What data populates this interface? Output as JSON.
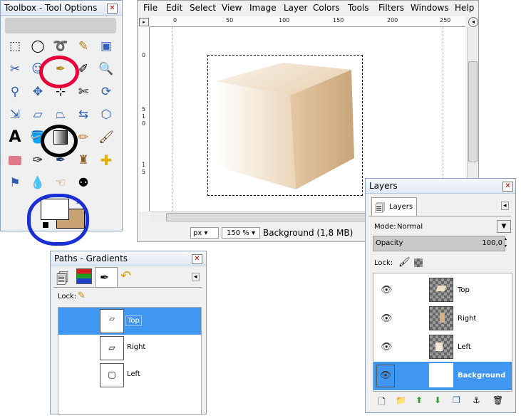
{
  "toolbox": {
    "title": "Toolbox - Tool Options",
    "close_glyph": "✕"
  },
  "image_window": {
    "menu": [
      "File",
      "Edit",
      "Select",
      "View",
      "Image",
      "Layer",
      "Colors",
      "Tools",
      "Filters",
      "Windows",
      "Help"
    ],
    "ruler_top": [
      "0",
      "50",
      "100",
      "150",
      "200",
      "250"
    ],
    "ruler_left": [
      "0",
      "5",
      "1",
      "0",
      "1",
      "5"
    ],
    "unit": "px",
    "zoom": "150 %",
    "status": "Background (1,8 MB)"
  },
  "layers": {
    "title": "Layers",
    "tab": "Layers",
    "mode_label": "Mode:",
    "mode_value": "Normal",
    "opacity_label": "Opacity",
    "opacity_value": "100,0",
    "lock_label": "Lock:",
    "items": [
      {
        "name": "Top",
        "selected": false
      },
      {
        "name": "Right",
        "selected": false
      },
      {
        "name": "Left",
        "selected": false
      },
      {
        "name": "Background",
        "selected": true
      }
    ]
  },
  "paths": {
    "title": "Paths - Gradients",
    "lock_label": "Lock:",
    "items": [
      {
        "name": "Top",
        "selected": true
      },
      {
        "name": "Right",
        "selected": false
      },
      {
        "name": "Left",
        "selected": false
      }
    ]
  },
  "colors": {
    "accent": "#3f97f1",
    "highlight_red": "#e8003a",
    "highlight_blue": "#1a2fd6",
    "bg_color_swatch": "#c8a272"
  }
}
